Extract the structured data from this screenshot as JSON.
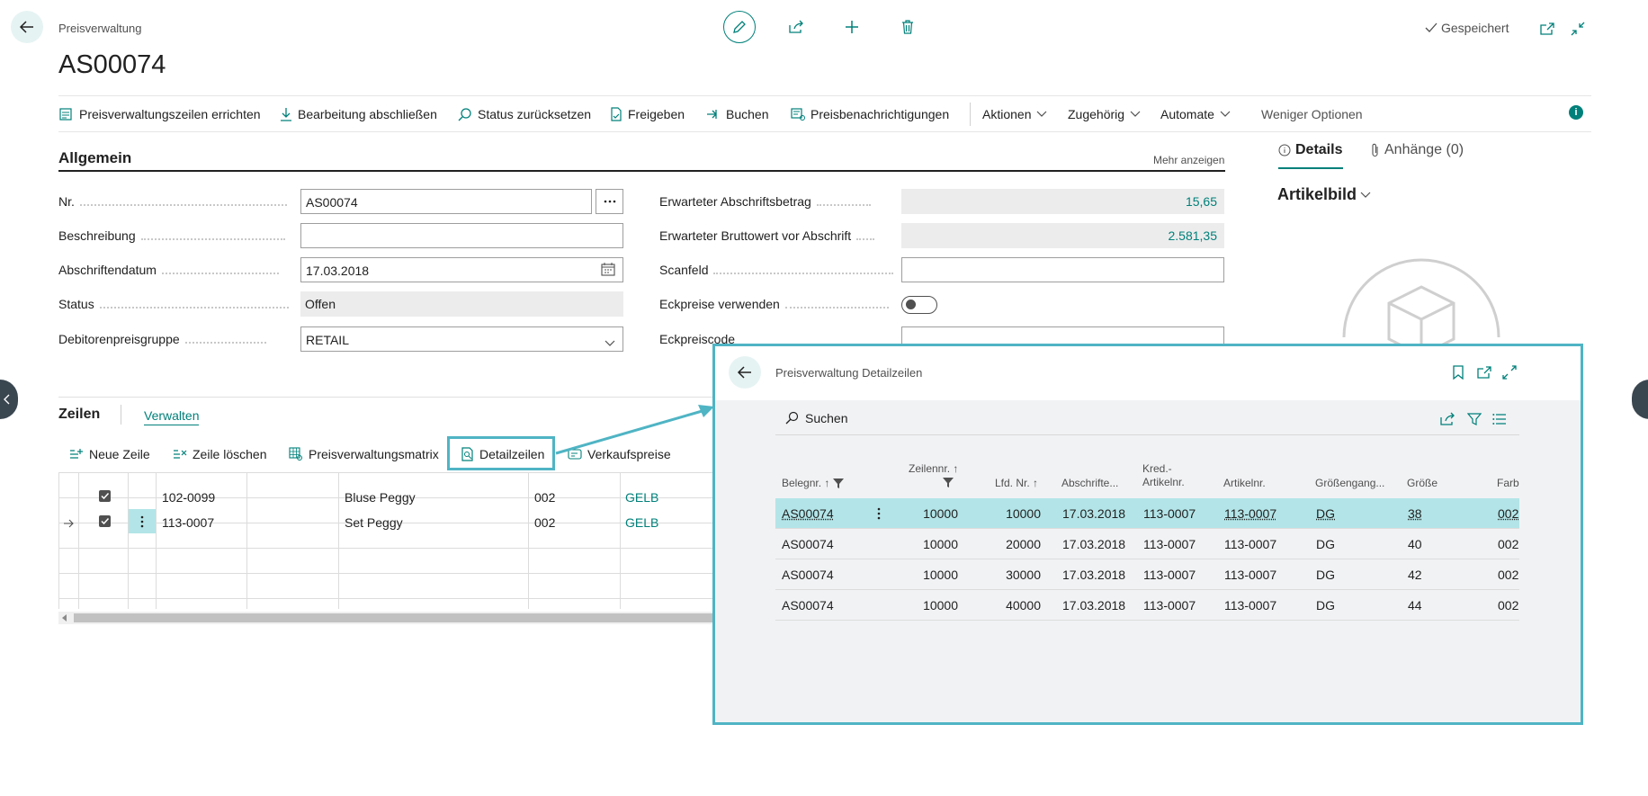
{
  "header": {
    "breadcrumb": "Preisverwaltung",
    "title": "AS00074",
    "saved_label": "Gespeichert"
  },
  "actions": {
    "items": [
      "Preisverwaltungszeilen errichten",
      "Bearbeitung abschließen",
      "Status zurücksetzen",
      "Freigeben",
      "Buchen",
      "Preisbenachrichtigungen"
    ],
    "menus": [
      "Aktionen",
      "Zugehörig",
      "Automate"
    ],
    "less_options": "Weniger Optionen"
  },
  "general": {
    "title": "Allgemein",
    "show_more": "Mehr anzeigen",
    "nr_label": "Nr.",
    "nr_value": "AS00074",
    "beschreibung_label": "Beschreibung",
    "beschreibung_value": "",
    "datum_label": "Abschriftendatum",
    "datum_value": "17.03.2018",
    "status_label": "Status",
    "status_value": "Offen",
    "debitor_label": "Debitorenpreisgruppe",
    "debitor_value": "RETAIL",
    "abschrift_label": "Erwarteter Abschriftsbetrag",
    "abschrift_value": "15,65",
    "brutto_label": "Erwarteter Bruttowert vor Abschrift",
    "brutto_value": "2.581,35",
    "scanfeld_label": "Scanfeld",
    "eckpreise_label": "Eckpreise verwenden",
    "eckpreise_enabled": false,
    "eckpreiscode_label": "Eckpreiscode"
  },
  "factbox": {
    "tab_details": "Details",
    "tab_attachments": "Anhänge (0)",
    "artikelbild": "Artikelbild"
  },
  "lines": {
    "title": "Zeilen",
    "manage": "Verwalten",
    "toolbar": [
      "Neue Zeile",
      "Zeile löschen",
      "Preisverwaltungsmatrix",
      "Detailzeilen",
      "Verkaufspreise"
    ],
    "rows": [
      {
        "artikelnr": "102-0099",
        "beschreibung": "Bluse Peggy",
        "code": "002",
        "farbe": "GELB",
        "checked": true
      },
      {
        "artikelnr": "113-0007",
        "beschreibung": "Set Peggy",
        "code": "002",
        "farbe": "GELB",
        "checked": true
      }
    ]
  },
  "dialog": {
    "title": "Preisverwaltung Detailzeilen",
    "search": "Suchen",
    "columns": {
      "belegnr": "Belegnr. ↑",
      "zeilennr": "Zeilennr. ↑",
      "lfdnr": "Lfd. Nr. ↑",
      "abschrifte": "Abschrifte...",
      "kred1": "Kred.-",
      "kred2": "Artikelnr.",
      "artikelnr": "Artikelnr.",
      "groesseng": "Größengang...",
      "groesse": "Größe",
      "farbe": "Farbc"
    },
    "rows": [
      {
        "belegnr": "AS00074",
        "zeilennr": "10000",
        "lfdnr": "10000",
        "datum": "17.03.2018",
        "kred": "113-0007",
        "artikel": "113-0007",
        "gg": "DG",
        "groesse": "38",
        "farbe": "002"
      },
      {
        "belegnr": "AS00074",
        "zeilennr": "10000",
        "lfdnr": "20000",
        "datum": "17.03.2018",
        "kred": "113-0007",
        "artikel": "113-0007",
        "gg": "DG",
        "groesse": "40",
        "farbe": "002"
      },
      {
        "belegnr": "AS00074",
        "zeilennr": "10000",
        "lfdnr": "30000",
        "datum": "17.03.2018",
        "kred": "113-0007",
        "artikel": "113-0007",
        "gg": "DG",
        "groesse": "42",
        "farbe": "002"
      },
      {
        "belegnr": "AS00074",
        "zeilennr": "10000",
        "lfdnr": "40000",
        "datum": "17.03.2018",
        "kred": "113-0007",
        "artikel": "113-0007",
        "gg": "DG",
        "groesse": "44",
        "farbe": "002"
      }
    ]
  },
  "colors": {
    "accent": "#00807a",
    "highlight": "#4fb4c4",
    "selected_row": "#b3e5e8"
  }
}
